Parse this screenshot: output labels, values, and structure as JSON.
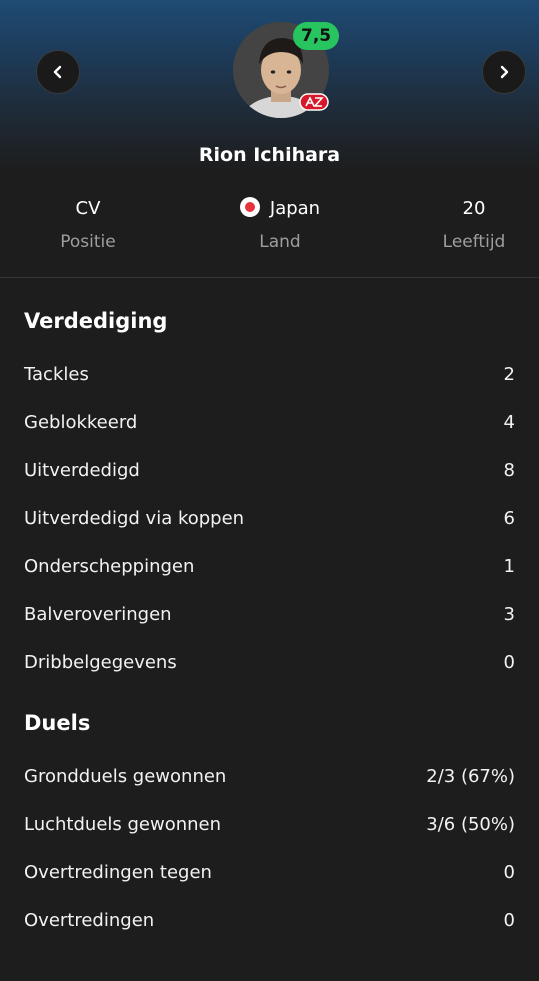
{
  "player": {
    "rating": "7,5",
    "name": "Rion Ichihara",
    "club_badge": "az-club-badge",
    "position_value": "CV",
    "position_label": "Positie",
    "country_value": "Japan",
    "country_label": "Land",
    "age_value": "20",
    "age_label": "Leeftijd"
  },
  "nav": {
    "prev_icon": "chevron-left-icon",
    "next_icon": "chevron-right-icon"
  },
  "sections": [
    {
      "title": "Verdediging",
      "rows": [
        {
          "label": "Tackles",
          "value": "2"
        },
        {
          "label": "Geblokkeerd",
          "value": "4"
        },
        {
          "label": "Uitverdedigd",
          "value": "8"
        },
        {
          "label": "Uitverdedigd via koppen",
          "value": "6"
        },
        {
          "label": "Onderscheppingen",
          "value": "1"
        },
        {
          "label": "Balveroveringen",
          "value": "3"
        },
        {
          "label": "Dribbelgegevens",
          "value": "0"
        }
      ]
    },
    {
      "title": "Duels",
      "rows": [
        {
          "label": "Grondduels gewonnen",
          "value": "2/3 (67%)"
        },
        {
          "label": "Luchtduels gewonnen",
          "value": "3/6 (50%)"
        },
        {
          "label": "Overtredingen tegen",
          "value": "0"
        },
        {
          "label": "Overtredingen",
          "value": "0"
        }
      ]
    }
  ],
  "colors": {
    "rating_bg": "#27c45f",
    "background": "#1d1d1d",
    "muted": "#9e9e9e",
    "flag_red": "#e8323c"
  }
}
